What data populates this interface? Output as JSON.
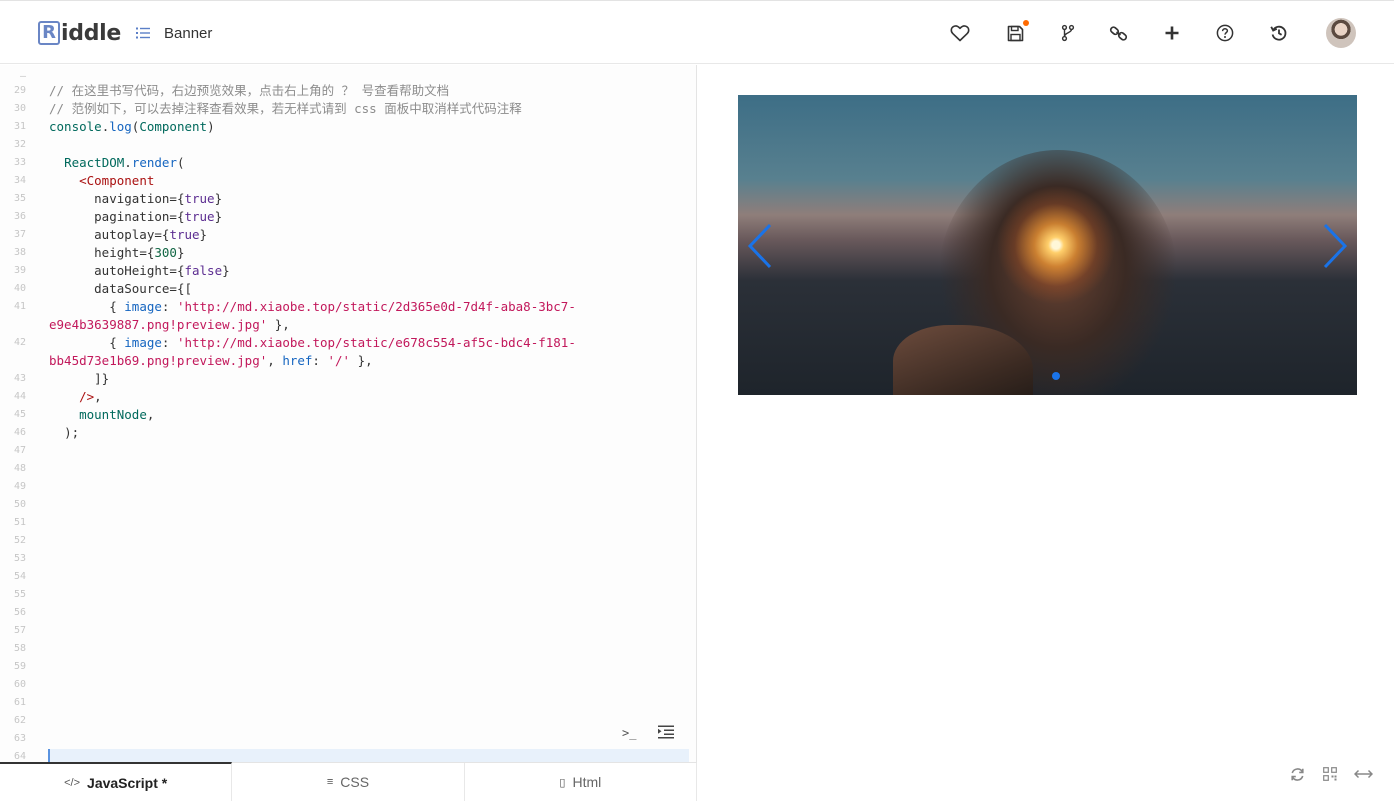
{
  "header": {
    "logo_initial": "R",
    "logo_rest": "iddle",
    "title": "Banner",
    "icons": [
      "heart-icon",
      "save-icon",
      "fork-icon",
      "link-icon",
      "plus-icon",
      "help-icon",
      "history-icon"
    ],
    "save_dot_color": "#ff6a00"
  },
  "editor": {
    "line_numbers": [
      "—",
      "29",
      "30",
      "31",
      "32",
      "33",
      "34",
      "35",
      "36",
      "37",
      "38",
      "39",
      "40",
      "41",
      "",
      "42",
      "",
      "43",
      "44",
      "45",
      "46",
      "47",
      "48",
      "49",
      "50",
      "51",
      "52",
      "53",
      "54",
      "55",
      "56",
      "57",
      "58",
      "59",
      "60",
      "61",
      "62",
      "63",
      "64"
    ],
    "lines": [
      {
        "indent": "",
        "tokens": [
          {
            "t": "// 在这里书写代码，右边预览效果，点击右上角的 ？ 号查看帮助文档",
            "c": "cm"
          }
        ]
      },
      {
        "indent": "",
        "tokens": [
          {
            "t": "// 范例如下，可以去掉注释查看效果，若无样式请到 css 面板中取消样式代码注释",
            "c": "cm"
          }
        ]
      },
      {
        "indent": "",
        "tokens": [
          {
            "t": "console",
            "c": "id"
          },
          {
            "t": ".",
            "c": "pl"
          },
          {
            "t": "log",
            "c": "kw"
          },
          {
            "t": "(",
            "c": "pl"
          },
          {
            "t": "Component",
            "c": "id"
          },
          {
            "t": ")",
            "c": "pl"
          }
        ]
      },
      {
        "indent": "",
        "tokens": []
      },
      {
        "indent": "  ",
        "tokens": [
          {
            "t": "ReactDOM",
            "c": "id"
          },
          {
            "t": ".",
            "c": "pl"
          },
          {
            "t": "render",
            "c": "kw"
          },
          {
            "t": "(",
            "c": "pl"
          }
        ]
      },
      {
        "indent": "    ",
        "tokens": [
          {
            "t": "<Component",
            "c": "tag"
          }
        ]
      },
      {
        "indent": "      ",
        "tokens": [
          {
            "t": "navigation",
            "c": "at2"
          },
          {
            "t": "={",
            "c": "pl"
          },
          {
            "t": "true",
            "c": "val"
          },
          {
            "t": "}",
            "c": "pl"
          }
        ]
      },
      {
        "indent": "      ",
        "tokens": [
          {
            "t": "pagination",
            "c": "at2"
          },
          {
            "t": "={",
            "c": "pl"
          },
          {
            "t": "true",
            "c": "val"
          },
          {
            "t": "}",
            "c": "pl"
          }
        ]
      },
      {
        "indent": "      ",
        "tokens": [
          {
            "t": "autoplay",
            "c": "at2"
          },
          {
            "t": "={",
            "c": "pl"
          },
          {
            "t": "true",
            "c": "val"
          },
          {
            "t": "}",
            "c": "pl"
          }
        ]
      },
      {
        "indent": "      ",
        "tokens": [
          {
            "t": "height",
            "c": "at2"
          },
          {
            "t": "={",
            "c": "pl"
          },
          {
            "t": "300",
            "c": "num"
          },
          {
            "t": "}",
            "c": "pl"
          }
        ]
      },
      {
        "indent": "      ",
        "tokens": [
          {
            "t": "autoHeight",
            "c": "at2"
          },
          {
            "t": "={",
            "c": "pl"
          },
          {
            "t": "false",
            "c": "val"
          },
          {
            "t": "}",
            "c": "pl"
          }
        ]
      },
      {
        "indent": "      ",
        "tokens": [
          {
            "t": "dataSource",
            "c": "at2"
          },
          {
            "t": "={[",
            "c": "pl"
          }
        ]
      },
      {
        "indent": "        ",
        "tokens": [
          {
            "t": "{ ",
            "c": "pl"
          },
          {
            "t": "image",
            "c": "at"
          },
          {
            "t": ": ",
            "c": "pl"
          },
          {
            "t": "'http://md.xiaobe.top/static/2d365e0d-7d4f-aba8-3bc7-",
            "c": "str"
          }
        ]
      },
      {
        "indent": "",
        "tokens": [
          {
            "t": "e9e4b3639887.png!preview.jpg'",
            "c": "str"
          },
          {
            "t": " },",
            "c": "pl"
          }
        ]
      },
      {
        "indent": "        ",
        "tokens": [
          {
            "t": "{ ",
            "c": "pl"
          },
          {
            "t": "image",
            "c": "at"
          },
          {
            "t": ": ",
            "c": "pl"
          },
          {
            "t": "'http://md.xiaobe.top/static/e678c554-af5c-bdc4-f181-",
            "c": "str"
          }
        ]
      },
      {
        "indent": "",
        "tokens": [
          {
            "t": "bb45d73e1b69.png!preview.jpg'",
            "c": "str"
          },
          {
            "t": ", ",
            "c": "pl"
          },
          {
            "t": "href",
            "c": "at"
          },
          {
            "t": ": ",
            "c": "pl"
          },
          {
            "t": "'/'",
            "c": "str"
          },
          {
            "t": " },",
            "c": "pl"
          }
        ]
      },
      {
        "indent": "      ",
        "tokens": [
          {
            "t": "]}",
            "c": "pl"
          }
        ]
      },
      {
        "indent": "    ",
        "tokens": [
          {
            "t": "/>",
            "c": "tag"
          },
          {
            "t": ",",
            "c": "pl"
          }
        ]
      },
      {
        "indent": "    ",
        "tokens": [
          {
            "t": "mountNode",
            "c": "id"
          },
          {
            "t": ",",
            "c": "pl"
          }
        ]
      },
      {
        "indent": "  ",
        "tokens": [
          {
            "t": ");",
            "c": "pl"
          }
        ]
      }
    ],
    "terminal_label": ">_"
  },
  "tabs": [
    {
      "label": "JavaScript *",
      "icon": "</>",
      "active": true
    },
    {
      "label": "CSS",
      "icon": "≡",
      "active": false
    },
    {
      "label": "Html",
      "icon": "▯",
      "active": false
    }
  ],
  "preview": {
    "banner": {
      "navigation": true,
      "pagination": true,
      "slide_count": 2,
      "active_index": 0,
      "accent": "#1a73e8"
    }
  },
  "footer_icons": [
    "refresh-icon",
    "qrcode-icon",
    "expand-icon"
  ]
}
